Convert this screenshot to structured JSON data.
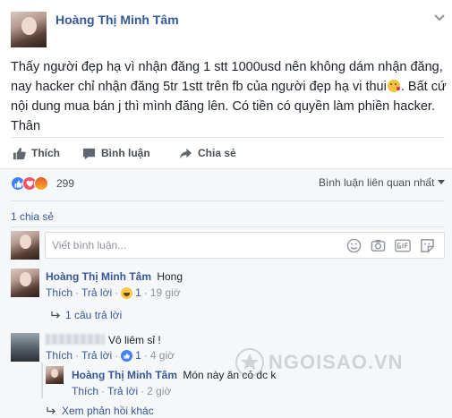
{
  "post": {
    "author": "Hoàng Thị Minh Tâm",
    "text_line1": "Thấy người đẹp hạ vì nhận đăng 1 stt 1000usd nên không dám nhận đăng,",
    "text_line2a": "nay hacker chỉ nhận đăng 5tr 1stt trên fb của người đẹp hạ vi thui",
    "text_line2b": ". Bất cứ",
    "text_line3": "nội dung mua bán j thì mình đăng lên. Có tiền có quyền làm phiền hacker.",
    "text_line4": "Thân"
  },
  "actions": {
    "like": "Thích",
    "comment": "Bình luận",
    "share": "Chia sẻ"
  },
  "reactions": {
    "count": "299",
    "sort_label": "Bình luận liên quan nhất"
  },
  "shares": "1 chia sẻ",
  "composer": {
    "placeholder": "Viết bình luận..."
  },
  "comments": [
    {
      "author": "Hoàng Thị Minh Tâm",
      "text": "Hong",
      "like": "Thích",
      "reply": "Trả lời",
      "reaction_count": "1",
      "time": "19 giờ",
      "replies_link": "1 câu trả lời"
    },
    {
      "text": "Vô liêm sỉ !",
      "like": "Thích",
      "reply": "Trả lời",
      "reaction_count": "1",
      "time": "4 giờ"
    }
  ],
  "reply": {
    "author": "Hoàng Thị Minh Tâm",
    "text": "Món này ăn cỏ dc k",
    "like": "Thích",
    "reply": "Trả lời",
    "time": "2 giờ"
  },
  "more_replies": "Xem phản hồi khác",
  "watermark": "NGOISAO.VN"
}
